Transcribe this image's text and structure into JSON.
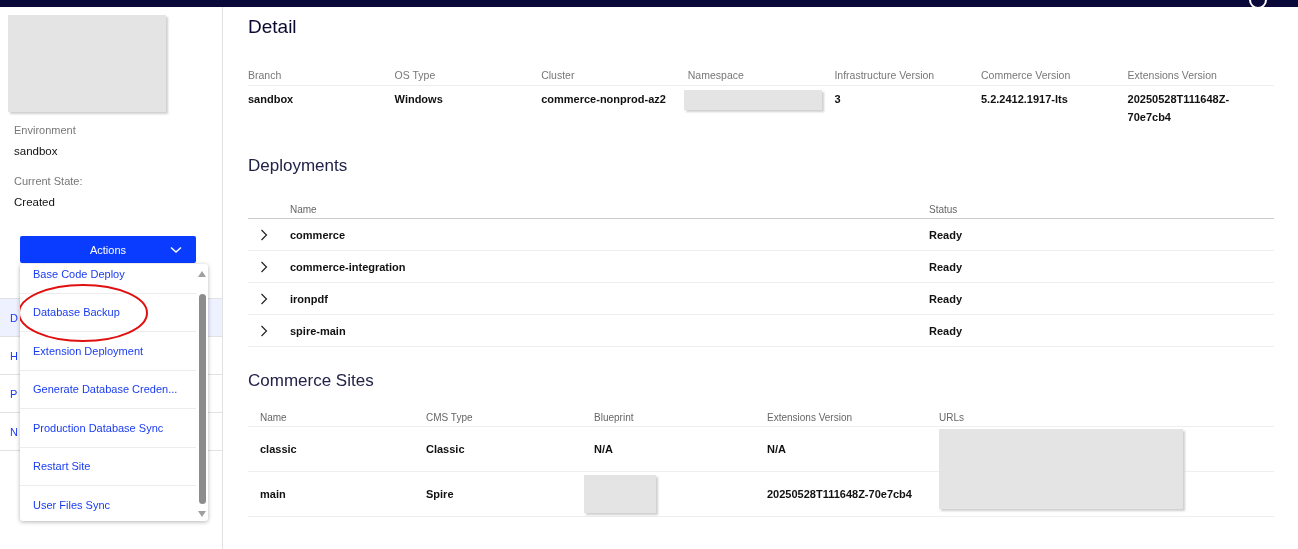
{
  "sidebar": {
    "logo": {
      "redacted": true
    },
    "fields": [
      {
        "label": "Environment",
        "value": "sandbox"
      },
      {
        "label": "Current State:",
        "value": "Created"
      }
    ],
    "actions_button": {
      "label": "Actions"
    },
    "actions_menu": {
      "items": [
        {
          "label": "Base Code Deploy",
          "circled": false
        },
        {
          "label": "Database Backup",
          "circled": true
        },
        {
          "label": "Extension Deployment",
          "circled": false
        },
        {
          "label": "Generate Database Creden...",
          "circled": false
        },
        {
          "label": "Production Database Sync",
          "circled": false
        },
        {
          "label": "Restart Site",
          "circled": false
        },
        {
          "label": "User Files Sync",
          "circled": false
        }
      ]
    },
    "nav_items": [
      {
        "label": "D",
        "selected": true
      },
      {
        "label": "H",
        "selected": false
      },
      {
        "label": "P",
        "selected": false
      },
      {
        "label": "N",
        "selected": false
      }
    ]
  },
  "detail": {
    "title": "Detail",
    "columns": [
      "Branch",
      "OS Type",
      "Cluster",
      "Namespace",
      "Infrastructure Version",
      "Commerce Version",
      "Extensions Version"
    ],
    "values": [
      {
        "text": "sandbox"
      },
      {
        "text": "Windows"
      },
      {
        "text": "commerce-nonprod-az2"
      },
      {
        "redacted": true
      },
      {
        "text": "3"
      },
      {
        "text": "5.2.2412.1917-lts"
      },
      {
        "text": "20250528T111648Z-70e7cb4"
      }
    ]
  },
  "deployments": {
    "title": "Deployments",
    "columns": [
      "Name",
      "Status"
    ],
    "rows": [
      {
        "name": "commerce",
        "status": "Ready",
        "expanded": false
      },
      {
        "name": "commerce-integration",
        "status": "Ready",
        "expanded": false
      },
      {
        "name": "ironpdf",
        "status": "Ready",
        "expanded": false
      },
      {
        "name": "spire-main",
        "status": "Ready",
        "expanded": false
      }
    ]
  },
  "commerce_sites": {
    "title": "Commerce Sites",
    "columns": [
      "Name",
      "CMS Type",
      "Blueprint",
      "Extensions Version",
      "URLs"
    ],
    "rows": [
      [
        {
          "text": "classic"
        },
        {
          "text": "Classic"
        },
        {
          "text": "N/A"
        },
        {
          "text": "N/A"
        },
        {
          "redacted": true
        }
      ],
      [
        {
          "text": "main"
        },
        {
          "text": "Spire"
        },
        {
          "redacted": true
        },
        {
          "text": "20250528T111648Z-70e7cb4"
        }
      ]
    ]
  }
}
